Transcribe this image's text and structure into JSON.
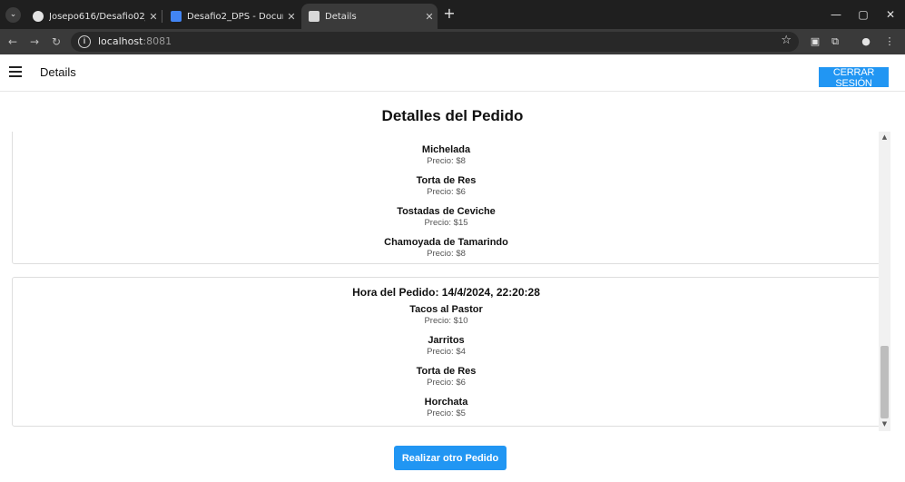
{
  "browser": {
    "tabs": [
      {
        "title": "Josepo616/Desafio02_DPS_Lab",
        "icon": "github-icon"
      },
      {
        "title": "Desafio2_DPS - Documentos de",
        "icon": "docs-icon"
      },
      {
        "title": "Details",
        "icon": "expo-icon"
      }
    ],
    "url_host": "localhost",
    "url_port": ":8081"
  },
  "header": {
    "title": "Details",
    "logout_label": "CERRAR SESIÓN"
  },
  "page": {
    "title": "Detalles del Pedido",
    "orders": [
      {
        "time_label": "",
        "items": [
          {
            "name": "Michelada",
            "price": "Precio: $8"
          },
          {
            "name": "Torta de Res",
            "price": "Precio: $6"
          },
          {
            "name": "Tostadas de Ceviche",
            "price": "Precio: $15"
          },
          {
            "name": "Chamoyada de Tamarindo",
            "price": "Precio: $8"
          }
        ]
      },
      {
        "time_label": "Hora del Pedido: 14/4/2024, 22:20:28",
        "items": [
          {
            "name": "Tacos al Pastor",
            "price": "Precio: $10"
          },
          {
            "name": "Jarritos",
            "price": "Precio: $4"
          },
          {
            "name": "Torta de Res",
            "price": "Precio: $6"
          },
          {
            "name": "Horchata",
            "price": "Precio: $5"
          }
        ]
      }
    ],
    "action_label": "Realizar otro Pedido"
  },
  "colors": {
    "accent": "#2196f3",
    "chrome_dark": "#1f1f1f"
  }
}
